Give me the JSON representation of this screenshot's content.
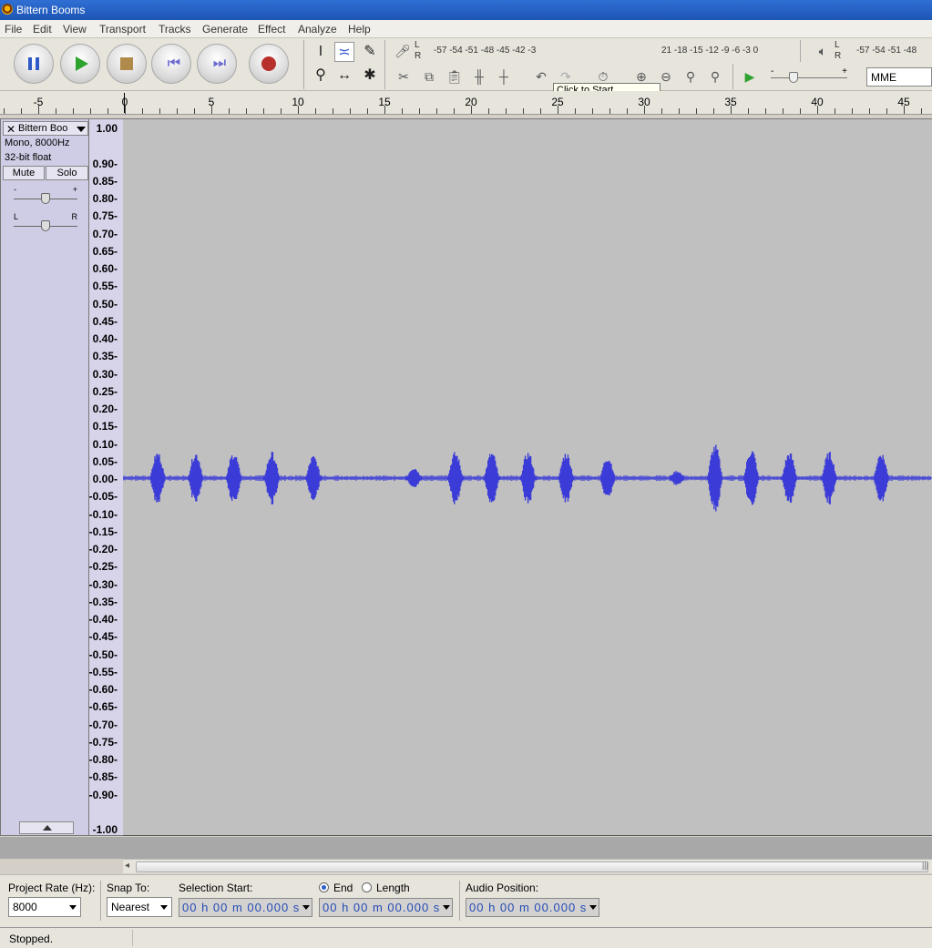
{
  "window": {
    "title": "Bittern Booms"
  },
  "menu": [
    "File",
    "Edit",
    "View",
    "Transport",
    "Tracks",
    "Generate",
    "Effect",
    "Analyze",
    "Help"
  ],
  "meters": {
    "record_lr": [
      "L",
      "R"
    ],
    "record_ticks": "-57 -54 -51 -48 -45 -42 -3",
    "record_ticks_tail": "21 -18 -15 -12  -9  -6  -3  0",
    "playback_lr": [
      "L",
      "R"
    ],
    "playback_ticks": "-57 -54 -51 -48",
    "tooltip": "Click to Start Monitoring"
  },
  "playback_volume": {
    "minus": "-",
    "plus": "+"
  },
  "audio_host": "MME",
  "ruler": {
    "labels": [
      "-5",
      "0",
      "5",
      "10",
      "15",
      "20",
      "25",
      "30",
      "35",
      "40",
      "45"
    ]
  },
  "track": {
    "name": "Bittern Boo",
    "format": "Mono, 8000Hz",
    "bit_depth": "32-bit float",
    "mute_label": "Mute",
    "solo_label": "Solo",
    "gain_minus": "-",
    "gain_plus": "+",
    "pan_left": "L",
    "pan_right": "R"
  },
  "amplitude_scale": [
    "1.00",
    "0.90-",
    "0.85-",
    "0.80-",
    "0.75-",
    "0.70-",
    "0.65-",
    "0.60-",
    "0.55-",
    "0.50-",
    "0.45-",
    "0.40-",
    "0.35-",
    "0.30-",
    "0.25-",
    "0.20-",
    "0.15-",
    "0.10-",
    "0.05-",
    "0.00-",
    "-0.05-",
    "-0.10-",
    "-0.15-",
    "-0.20-",
    "-0.25-",
    "-0.30-",
    "-0.35-",
    "-0.40-",
    "-0.45-",
    "-0.50-",
    "-0.55-",
    "-0.60-",
    "-0.65-",
    "-0.70-",
    "-0.75-",
    "-0.80-",
    "-0.85-",
    "-0.90-",
    "-1.00"
  ],
  "waveform": {
    "color": "#3b3bd8",
    "booms": [
      {
        "t": 2.0,
        "amp": 0.07
      },
      {
        "t": 4.2,
        "amp": 0.07
      },
      {
        "t": 6.4,
        "amp": 0.07
      },
      {
        "t": 8.6,
        "amp": 0.07
      },
      {
        "t": 11.0,
        "amp": 0.06
      },
      {
        "t": 16.8,
        "amp": 0.03
      },
      {
        "t": 19.2,
        "amp": 0.07
      },
      {
        "t": 21.3,
        "amp": 0.07
      },
      {
        "t": 23.4,
        "amp": 0.07
      },
      {
        "t": 25.6,
        "amp": 0.07
      },
      {
        "t": 28.0,
        "amp": 0.06
      },
      {
        "t": 32.0,
        "amp": 0.02
      },
      {
        "t": 34.2,
        "amp": 0.09
      },
      {
        "t": 36.3,
        "amp": 0.08
      },
      {
        "t": 38.5,
        "amp": 0.07
      },
      {
        "t": 40.8,
        "amp": 0.07
      },
      {
        "t": 43.8,
        "amp": 0.07
      }
    ]
  },
  "selection_bar": {
    "project_rate_label": "Project Rate (Hz):",
    "project_rate": "8000",
    "snap_to_label": "Snap To:",
    "snap_to": "Nearest",
    "selection_start_label": "Selection Start:",
    "end_label": "End",
    "length_label": "Length",
    "audio_position_label": "Audio Position:",
    "selection_start": "00 h 00 m 00.000 s",
    "selection_end": "00 h 00 m 00.000 s",
    "audio_position": "00 h 00 m 00.000 s"
  },
  "status": "Stopped."
}
